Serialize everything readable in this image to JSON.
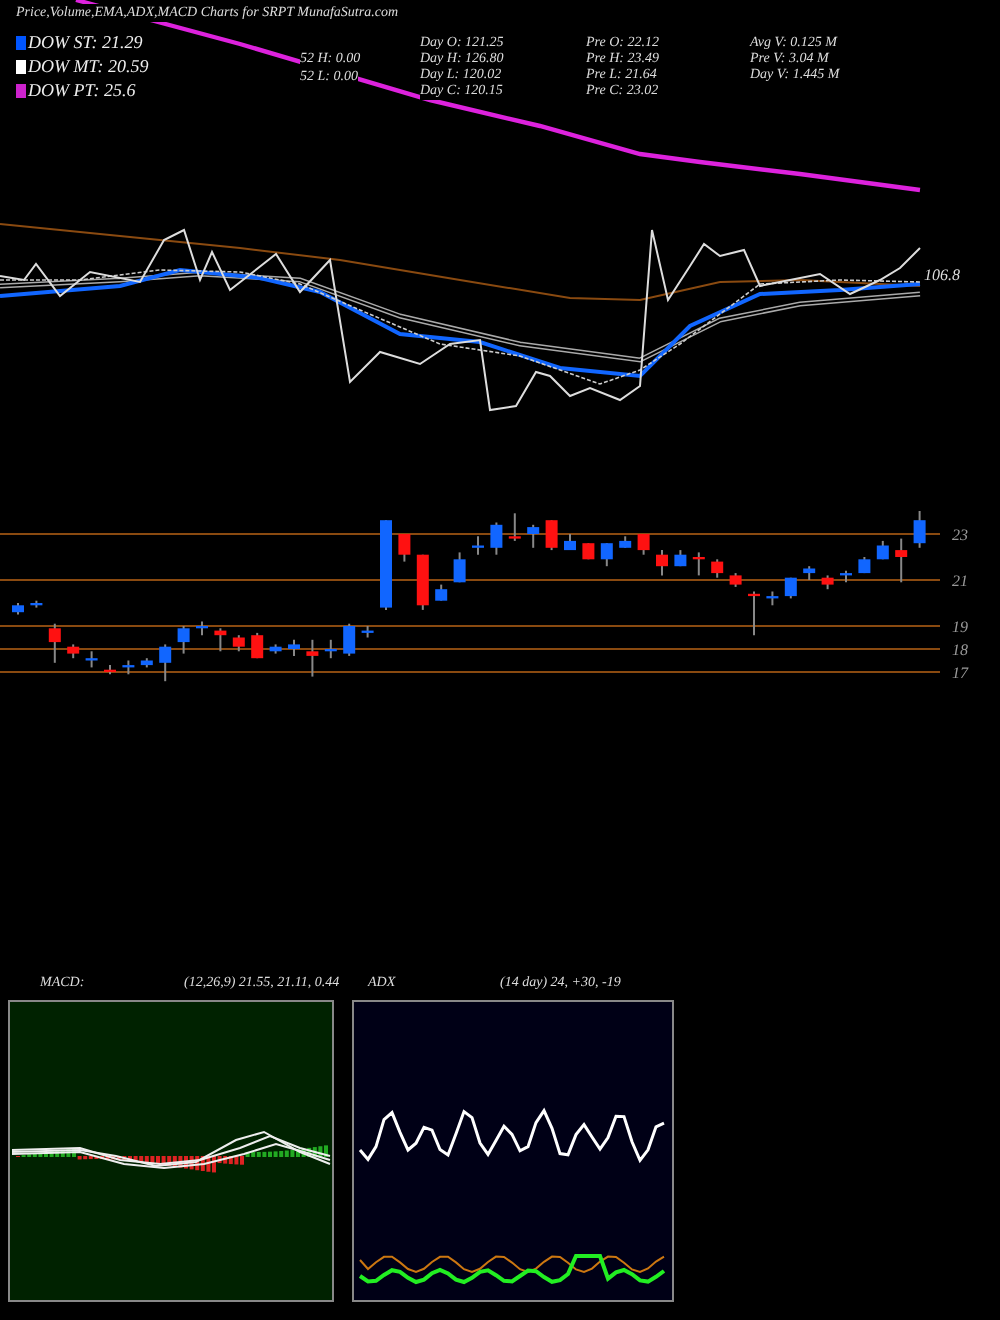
{
  "title": "Price,Volume,EMA,ADX,MACD Charts for SRPT MunafaSutra.com",
  "legend": [
    {
      "label": "DOW ST: 21.29",
      "color": "#0055ff"
    },
    {
      "label": "DOW MT: 20.59",
      "color": "#ffffff"
    },
    {
      "label": "DOW PT: 25.6",
      "color": "#cc22cc"
    }
  ],
  "week52": [
    "52 H: 0.00",
    "52 L: 0.00"
  ],
  "stats": [
    [
      "Day O: 121.25",
      "Day H: 126.80",
      "Day L: 120.02",
      "Day C: 120.15"
    ],
    [
      "Pre O: 22.12",
      "Pre H: 23.49",
      "Pre L: 21.64",
      "Pre C: 23.02"
    ],
    [
      "Avg V: 0.125 M",
      "Pre V: 3.04 M",
      "Day V: 1.445 M"
    ]
  ],
  "ema_label": "106.8",
  "price_panel": {
    "chart_data": {
      "type": "candlestick",
      "grid": true,
      "ylim": [
        17,
        23
      ],
      "yticks": [
        23,
        21,
        19,
        18,
        17
      ],
      "ohlc": [
        [
          19.6,
          20.0,
          19.5,
          19.9
        ],
        [
          19.9,
          20.1,
          19.8,
          20.0
        ],
        [
          18.9,
          19.1,
          17.4,
          18.3
        ],
        [
          18.1,
          18.2,
          17.6,
          17.8
        ],
        [
          17.5,
          17.9,
          17.2,
          17.6
        ],
        [
          17.1,
          17.3,
          16.9,
          17.0
        ],
        [
          17.2,
          17.5,
          16.9,
          17.3
        ],
        [
          17.3,
          17.6,
          17.2,
          17.5
        ],
        [
          17.4,
          18.2,
          16.6,
          18.1
        ],
        [
          18.3,
          19.0,
          17.8,
          18.9
        ],
        [
          18.9,
          19.2,
          18.6,
          19.0
        ],
        [
          18.8,
          18.9,
          17.9,
          18.6
        ],
        [
          18.5,
          18.6,
          17.9,
          18.1
        ],
        [
          18.6,
          18.7,
          17.6,
          17.6
        ],
        [
          17.9,
          18.2,
          17.8,
          18.1
        ],
        [
          18.0,
          18.4,
          17.7,
          18.2
        ],
        [
          17.9,
          18.4,
          16.8,
          17.7
        ],
        [
          17.9,
          18.4,
          17.6,
          18.0
        ],
        [
          17.8,
          19.1,
          17.7,
          19.0
        ],
        [
          18.7,
          19.0,
          18.5,
          18.8
        ],
        [
          19.8,
          23.6,
          19.7,
          23.6
        ],
        [
          23.0,
          23.0,
          21.8,
          22.1
        ],
        [
          22.1,
          22.1,
          19.7,
          19.9
        ],
        [
          20.1,
          20.8,
          20.1,
          20.6
        ],
        [
          20.9,
          22.2,
          20.9,
          21.9
        ],
        [
          22.4,
          22.9,
          22.1,
          22.5
        ],
        [
          22.4,
          23.5,
          22.1,
          23.4
        ],
        [
          22.9,
          23.9,
          22.7,
          22.8
        ],
        [
          23.0,
          23.4,
          22.4,
          23.3
        ],
        [
          23.6,
          23.6,
          22.3,
          22.4
        ],
        [
          22.3,
          23.0,
          22.3,
          22.7
        ],
        [
          22.6,
          22.6,
          21.9,
          21.9
        ],
        [
          21.9,
          22.6,
          21.6,
          22.6
        ],
        [
          22.4,
          22.9,
          22.4,
          22.7
        ],
        [
          23.0,
          23.0,
          22.1,
          22.3
        ],
        [
          22.1,
          22.3,
          21.2,
          21.6
        ],
        [
          21.6,
          22.3,
          21.6,
          22.1
        ],
        [
          22.0,
          22.2,
          21.2,
          21.9
        ],
        [
          21.8,
          21.9,
          21.1,
          21.3
        ],
        [
          21.2,
          21.3,
          20.7,
          20.8
        ],
        [
          20.4,
          20.5,
          18.6,
          20.3
        ],
        [
          20.2,
          20.5,
          19.9,
          20.3
        ],
        [
          20.3,
          21.1,
          20.2,
          21.1
        ],
        [
          21.3,
          21.6,
          21.0,
          21.5
        ],
        [
          21.1,
          21.2,
          20.6,
          20.8
        ],
        [
          21.2,
          21.4,
          20.9,
          21.3
        ],
        [
          21.3,
          22.0,
          21.3,
          21.9
        ],
        [
          21.9,
          22.7,
          21.9,
          22.5
        ],
        [
          22.3,
          22.8,
          20.9,
          22.0
        ],
        [
          22.6,
          24.0,
          22.4,
          23.6
        ]
      ]
    }
  },
  "macd": {
    "title": "MACD:",
    "params": "(12,26,9) 21.55, 21.11, 0.44"
  },
  "adx": {
    "title": "ADX",
    "params": "(14 day) 24, +30, -19"
  }
}
